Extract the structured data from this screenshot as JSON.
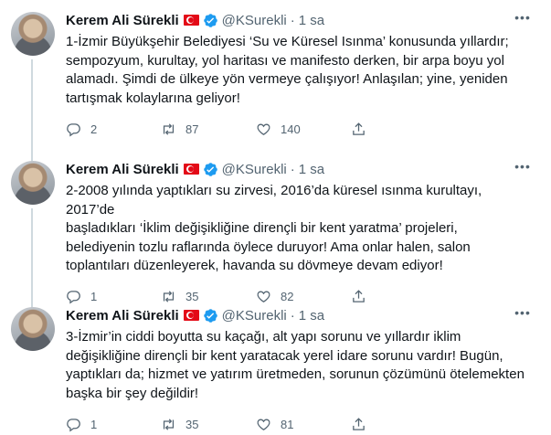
{
  "tweets": [
    {
      "author": {
        "name": "Kerem Ali Sürekli",
        "handle": "@KSurekli",
        "verified": true,
        "flag": "turkey-flag"
      },
      "time": "1 sa",
      "text": "1-İzmir Büyükşehir Belediyesi ‘Su ve Küresel Isınma’ konusunda yıllardır;\nsempozyum, kurultay, yol haritası ve manifesto derken, bir arpa boyu yol\nalamadı. Şimdi de ülkeye yön vermeye çalışıyor! Anlaşılan; yine, yeniden\ntartışmak kolaylarına geliyor!",
      "replies": "2",
      "retweets": "87",
      "likes": "140"
    },
    {
      "author": {
        "name": "Kerem Ali Sürekli",
        "handle": "@KSurekli",
        "verified": true,
        "flag": "turkey-flag"
      },
      "time": "1 sa",
      "text": "2-2008 yılında yaptıkları su zirvesi, 2016’da küresel ısınma kurultayı, 2017’de\nbaşladıkları ‘İklim değişikliğine dirençli bir kent yaratma’ projeleri,\nbelediyenin tozlu raflarında öylece duruyor! Ama onlar halen, salon\ntoplantıları düzenleyerek, havanda su dövmeye devam ediyor!",
      "replies": "1",
      "retweets": "35",
      "likes": "82"
    },
    {
      "author": {
        "name": "Kerem Ali Sürekli",
        "handle": "@KSurekli",
        "verified": true,
        "flag": "turkey-flag"
      },
      "time": "1 sa",
      "text": "3-İzmir’in ciddi boyutta su kaçağı, alt yapı sorunu ve yıllardır iklim\ndeğişikliğine dirençli bir kent yaratacak yerel idare sorunu vardır! Bugün,\nyaptıkları da; hizmet ve yatırım üretmeden, sorunun çözümünü ötelemekten\nbaşka bir şey değildir!",
      "replies": "1",
      "retweets": "35",
      "likes": "81"
    }
  ],
  "separator": "·",
  "colors": {
    "text": "#0f1419",
    "secondary": "#536471",
    "verified": "#1d9bf0",
    "thread_line": "#cfd9de",
    "flag_red": "#e30a17"
  },
  "icons": {
    "reply": "reply-icon",
    "retweet": "retweet-icon",
    "like": "heart-icon",
    "share": "share-icon",
    "more": "more-icon",
    "verified": "verified-badge-icon"
  }
}
